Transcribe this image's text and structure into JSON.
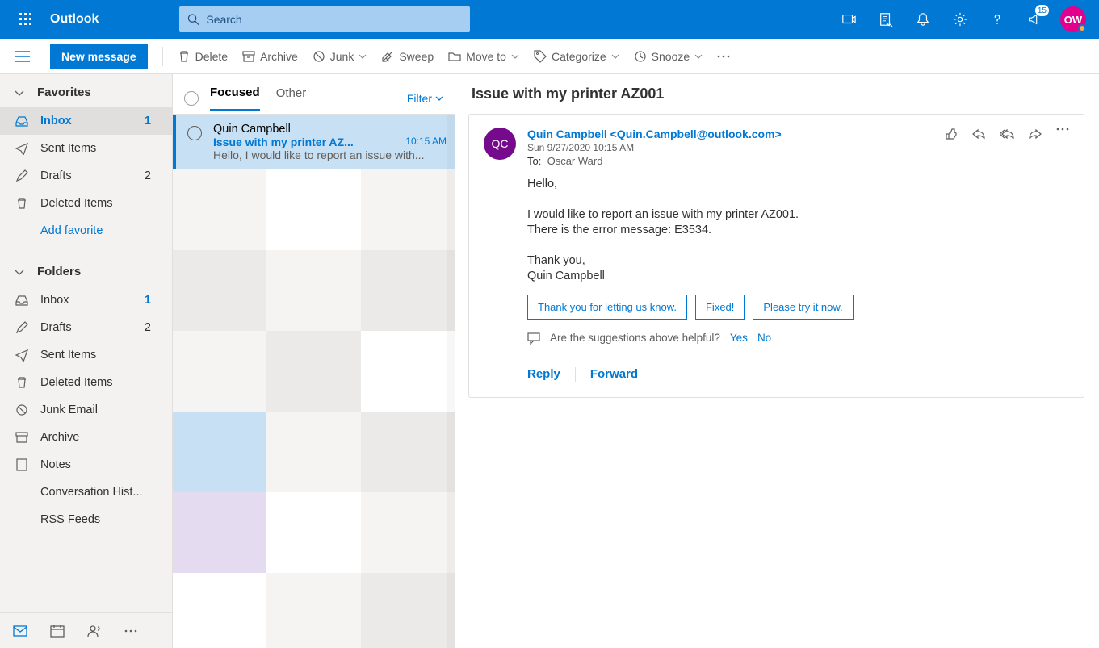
{
  "app_name": "Outlook",
  "search_placeholder": "Search",
  "header_badge": "15",
  "avatar_initials": "OW",
  "new_message": "New message",
  "toolbar": {
    "delete": "Delete",
    "archive": "Archive",
    "junk": "Junk",
    "sweep": "Sweep",
    "moveto": "Move to",
    "categorize": "Categorize",
    "snooze": "Snooze"
  },
  "sidebar": {
    "favorites_label": "Favorites",
    "folders_label": "Folders",
    "add_favorite": "Add favorite",
    "favorites": [
      {
        "label": "Inbox",
        "count": "1",
        "active": true
      },
      {
        "label": "Sent Items",
        "count": ""
      },
      {
        "label": "Drafts",
        "count": "2"
      },
      {
        "label": "Deleted Items",
        "count": ""
      }
    ],
    "folders": [
      {
        "label": "Inbox",
        "count": "1"
      },
      {
        "label": "Drafts",
        "count": "2"
      },
      {
        "label": "Sent Items",
        "count": ""
      },
      {
        "label": "Deleted Items",
        "count": ""
      },
      {
        "label": "Junk Email",
        "count": ""
      },
      {
        "label": "Archive",
        "count": ""
      },
      {
        "label": "Notes",
        "count": ""
      },
      {
        "label": "Conversation Hist...",
        "count": ""
      },
      {
        "label": "RSS Feeds",
        "count": ""
      }
    ]
  },
  "list": {
    "tab_focused": "Focused",
    "tab_other": "Other",
    "filter": "Filter",
    "msg": {
      "from": "Quin Campbell",
      "subject": "Issue with my printer AZ...",
      "time": "10:15 AM",
      "preview": "Hello, I would like to report an issue with..."
    }
  },
  "read": {
    "title": "Issue with my printer AZ001",
    "avatar_initials": "QC",
    "sender": "Quin Campbell <Quin.Campbell@outlook.com>",
    "date": "Sun 9/27/2020 10:15 AM",
    "to_label": "To:",
    "to_value": "Oscar Ward",
    "body_p1": "Hello,",
    "body_p2": "I would like to report an issue with my printer AZ001.\nThere is the error message: E3534.",
    "body_p3": "Thank you,\nQuin Campbell",
    "suggest1": "Thank you for letting us know.",
    "suggest2": "Fixed!",
    "suggest3": "Please try it now.",
    "feedback_q": "Are the suggestions above helpful?",
    "yes": "Yes",
    "no": "No",
    "reply": "Reply",
    "forward": "Forward"
  }
}
